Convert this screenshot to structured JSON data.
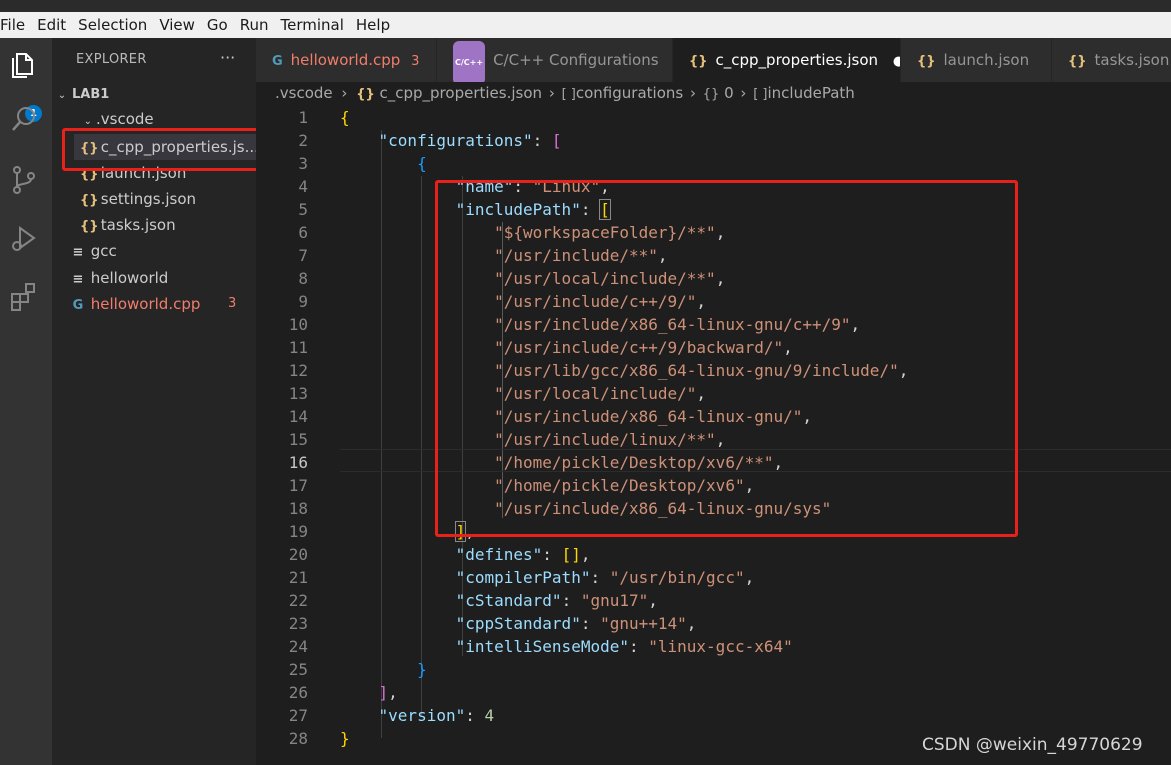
{
  "menu": [
    "File",
    "Edit",
    "Selection",
    "View",
    "Go",
    "Run",
    "Terminal",
    "Help"
  ],
  "activity": {
    "explorer_badge": "1",
    "icons": [
      "files-icon",
      "search-icon",
      "source-control-icon",
      "run-debug-icon",
      "extensions-icon"
    ]
  },
  "sidebar": {
    "title": "EXPLORER",
    "more": "···",
    "root": "LAB1",
    "vscode_folder": ".vscode",
    "files_json": [
      "c_cpp_properties.js...",
      "launch.json",
      "settings.json",
      "tasks.json"
    ],
    "files_root": [
      {
        "name": "gcc",
        "icon": "≡"
      },
      {
        "name": "helloworld",
        "icon": "≡"
      },
      {
        "name": "helloworld.cpp",
        "icon": "G",
        "badge": "3"
      }
    ]
  },
  "tabs": [
    {
      "label": "helloworld.cpp",
      "icon": "G",
      "badge": "3"
    },
    {
      "label": "C/C++ Configurations",
      "icon": "C/C++"
    },
    {
      "label": "c_cpp_properties.json",
      "icon": "{}",
      "dirty": "●"
    },
    {
      "label": "launch.json",
      "icon": "{}"
    },
    {
      "label": "tasks.json",
      "icon": "{}"
    }
  ],
  "breadcrumb": [
    ".vscode",
    "c_cpp_properties.json",
    "configurations",
    "0",
    "includePath"
  ],
  "code": {
    "line_numbers": [
      "1",
      "2",
      "3",
      "4",
      "5",
      "6",
      "7",
      "8",
      "9",
      "10",
      "11",
      "12",
      "13",
      "14",
      "15",
      "16",
      "17",
      "18",
      "19",
      "20",
      "21",
      "22",
      "23",
      "24",
      "25",
      "26",
      "27",
      "28"
    ],
    "include_paths": [
      "\"${workspaceFolder}/**\"",
      "\"/usr/include/**\"",
      "\"/usr/local/include/**\"",
      "\"/usr/include/c++/9/\"",
      "\"/usr/include/x86_64-linux-gnu/c++/9\"",
      "\"/usr/include/c++/9/backward/\"",
      "\"/usr/lib/gcc/x86_64-linux-gnu/9/include/\"",
      "\"/usr/local/include/\"",
      "\"/usr/include/x86_64-linux-gnu/\"",
      "\"/usr/include/linux/**\"",
      "\"/home/pickle/Desktop/xv6/**\"",
      "\"/home/pickle/Desktop/xv6\"",
      "\"/usr/include/x86_64-linux-gnu/sys\""
    ],
    "keys": {
      "configurations": "\"configurations\"",
      "name": "\"name\"",
      "name_val": "\"Linux\"",
      "includePath": "\"includePath\"",
      "defines": "\"defines\"",
      "compilerPath": "\"compilerPath\"",
      "compilerPath_val": "\"/usr/bin/gcc\"",
      "cStandard": "\"cStandard\"",
      "cStandard_val": "\"gnu17\"",
      "cppStandard": "\"cppStandard\"",
      "cppStandard_val": "\"gnu++14\"",
      "intelliSenseMode": "\"intelliSenseMode\"",
      "intelliSenseMode_val": "\"linux-gcc-x64\"",
      "version": "\"version\"",
      "version_val": "4"
    }
  },
  "watermark": "CSDN @weixin_49770629",
  "colors": {
    "highlight_box": "#e8211b",
    "accent": "#007acc"
  }
}
